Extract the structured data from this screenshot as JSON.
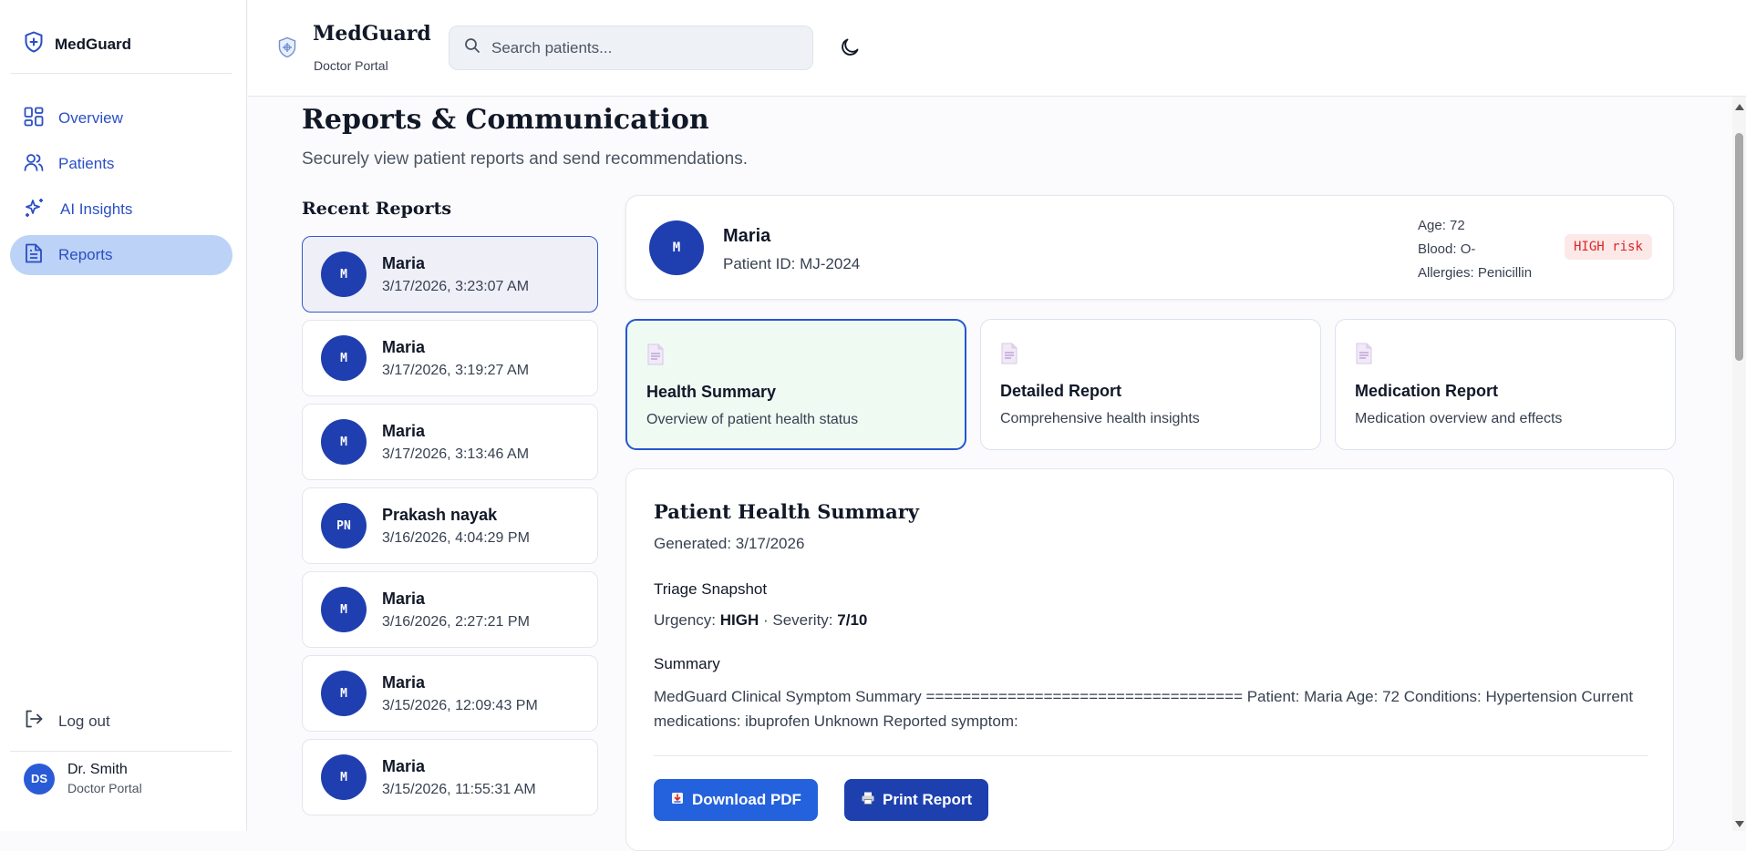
{
  "sidebar": {
    "brand": "MedGuard",
    "nav": [
      {
        "label": "Overview",
        "icon": "layout-grid-icon"
      },
      {
        "label": "Patients",
        "icon": "users-icon"
      },
      {
        "label": "AI Insights",
        "icon": "sparkles-icon"
      },
      {
        "label": "Reports",
        "icon": "file-text-icon",
        "active": true
      }
    ],
    "logout": "Log out",
    "user": {
      "initials": "DS",
      "name": "Dr. Smith",
      "role": "Doctor Portal"
    }
  },
  "header": {
    "title": "MedGuard",
    "subtitle": "Doctor Portal",
    "search_placeholder": "Search patients..."
  },
  "main": {
    "title": "Reports & Communication",
    "subtitle": "Securely view patient reports and send recommendations.",
    "recent_title": "Recent Reports",
    "reports": [
      {
        "initials": "M",
        "name": "Maria",
        "date": "3/17/2026, 3:23:07 AM"
      },
      {
        "initials": "M",
        "name": "Maria",
        "date": "3/17/2026, 3:19:27 AM"
      },
      {
        "initials": "M",
        "name": "Maria",
        "date": "3/17/2026, 3:13:46 AM"
      },
      {
        "initials": "PN",
        "name": "Prakash nayak",
        "date": "3/16/2026, 4:04:29 PM"
      },
      {
        "initials": "M",
        "name": "Maria",
        "date": "3/16/2026, 2:27:21 PM"
      },
      {
        "initials": "M",
        "name": "Maria",
        "date": "3/15/2026, 12:09:43 PM"
      },
      {
        "initials": "M",
        "name": "Maria",
        "date": "3/15/2026, 11:55:31 AM"
      }
    ],
    "patient": {
      "initials": "M",
      "name": "Maria",
      "id": "Patient ID: MJ-2024",
      "age": "Age: 72",
      "blood": "Blood: O-",
      "allergies": "Allergies: Penicillin",
      "risk": "HIGH risk"
    },
    "report_types": [
      {
        "title": "Health Summary",
        "desc": "Overview of patient health status"
      },
      {
        "title": "Detailed Report",
        "desc": "Comprehensive health insights"
      },
      {
        "title": "Medication Report",
        "desc": "Medication overview and effects"
      }
    ],
    "summary": {
      "title": "Patient Health Summary",
      "generated": "Generated: 3/17/2026",
      "triage_heading": "Triage Snapshot",
      "urgency_label": "Urgency:",
      "urgency_value": "HIGH",
      "severity_label": "· Severity:",
      "severity_value": "7/10",
      "summary_heading": "Summary",
      "summary_text": "MedGuard Clinical Symptom Summary =================================== Patient: Maria Age: 72 Conditions: Hypertension Current medications: ibuprofen Unknown Reported symptom:",
      "download_label": "Download PDF",
      "print_label": "Print Report"
    }
  },
  "colors": {
    "primary": "#2461dd",
    "primary_dark": "#1d40ae",
    "active_nav": "#bcd2f6",
    "risk_bg": "#fde8e8",
    "risk_fg": "#dc2626"
  }
}
